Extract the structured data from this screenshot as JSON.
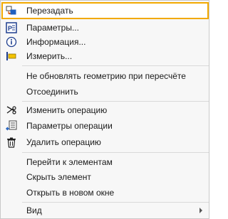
{
  "menu": {
    "items": [
      {
        "label": "Перезадать",
        "icon": "redefine-icon"
      },
      {
        "label": "Параметры...",
        "icon": "parameters-icon"
      },
      {
        "label": "Информация...",
        "icon": "info-icon"
      },
      {
        "label": "Измерить...",
        "icon": "measure-icon"
      },
      {
        "label": "Не обновлять геометрию при пересчёте"
      },
      {
        "label": "Отсоединить"
      },
      {
        "label": "Изменить операцию",
        "icon": "edit-operation-icon"
      },
      {
        "label": "Параметры операции",
        "icon": "operation-parameters-icon"
      },
      {
        "label": "Удалить операцию",
        "icon": "trash-icon"
      },
      {
        "label": "Перейти к элементам"
      },
      {
        "label": "Скрыть элемент"
      },
      {
        "label": "Открыть в новом окне"
      },
      {
        "label": "Вид",
        "has_submenu": true
      }
    ]
  },
  "colors": {
    "highlight_border": "#f2a900",
    "menu_background": "#f7f7f7",
    "icon_blue": "#1f5fbf"
  }
}
